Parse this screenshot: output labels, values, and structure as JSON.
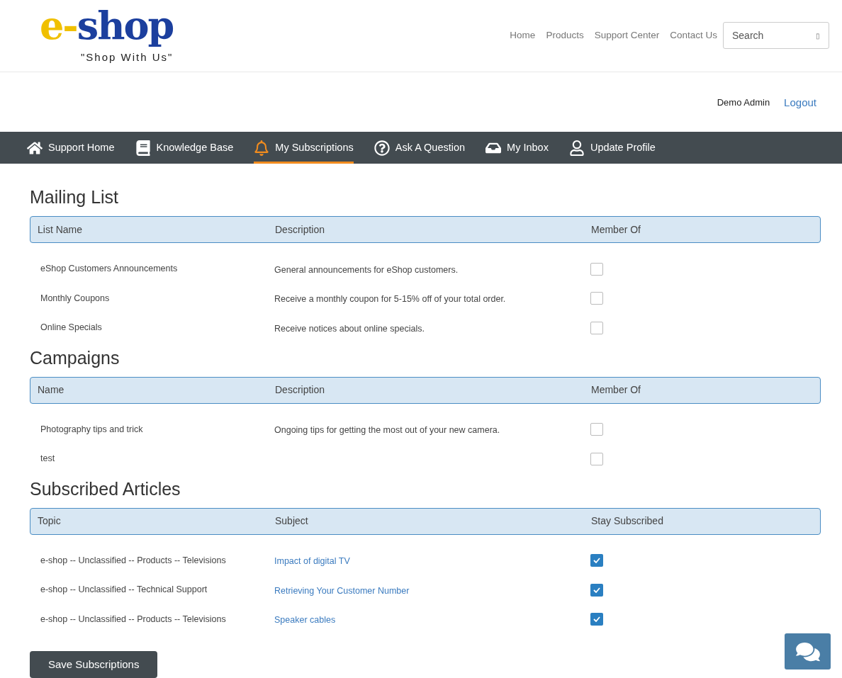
{
  "logo": {
    "prefix": "e-",
    "name": "shop",
    "tagline": "\"Shop With Us\""
  },
  "top_nav": [
    {
      "label": "Home"
    },
    {
      "label": "Products"
    },
    {
      "label": "Support Center"
    },
    {
      "label": "Contact Us"
    }
  ],
  "search": {
    "placeholder": "Search",
    "button": "▯"
  },
  "user": {
    "name": "Demo Admin",
    "logout": "Logout"
  },
  "support_nav": [
    {
      "label": "Support Home",
      "selected": false
    },
    {
      "label": "Knowledge Base",
      "selected": false
    },
    {
      "label": "My Subscriptions",
      "selected": true
    },
    {
      "label": "Ask A Question",
      "selected": false
    },
    {
      "label": "My Inbox",
      "selected": false
    },
    {
      "label": "Update Profile",
      "selected": false
    }
  ],
  "sections": [
    {
      "title": "Mailing List",
      "columns": [
        "List Name",
        "Description",
        "Member Of"
      ],
      "rows": [
        {
          "kind": "text",
          "name": "eShop Customers Announcements",
          "detail": "General announcements for eShop customers.",
          "checked": false
        },
        {
          "kind": "text",
          "name": "Monthly Coupons",
          "detail": "Receive a monthly coupon for 5-15% off of your total order.",
          "checked": false
        },
        {
          "kind": "text",
          "name": "Online Specials",
          "detail": "Receive notices about online specials.",
          "checked": false
        }
      ]
    },
    {
      "title": "Campaigns",
      "columns": [
        "Name",
        "Description",
        "Member Of"
      ],
      "rows": [
        {
          "kind": "text",
          "name": "Photography tips and trick",
          "detail": "Ongoing tips for getting the most out of your new camera.",
          "checked": false
        },
        {
          "name": "test",
          "checked": false
        }
      ]
    },
    {
      "title": "Subscribed Articles",
      "columns": [
        "Topic",
        "Subject",
        "Stay Subscribed"
      ],
      "rows": [
        {
          "kind": "link",
          "name": "e-shop -- Unclassified -- Products -- Televisions",
          "detail": "Impact of digital TV",
          "checked": true
        },
        {
          "kind": "link",
          "name": "e-shop -- Unclassified -- Technical Support",
          "detail": "Retrieving Your Customer Number",
          "checked": true
        },
        {
          "kind": "link",
          "name": "e-shop -- Unclassified -- Products -- Televisions",
          "detail": "Speaker cables",
          "checked": true
        }
      ]
    }
  ],
  "save_button": "Save Subscriptions"
}
